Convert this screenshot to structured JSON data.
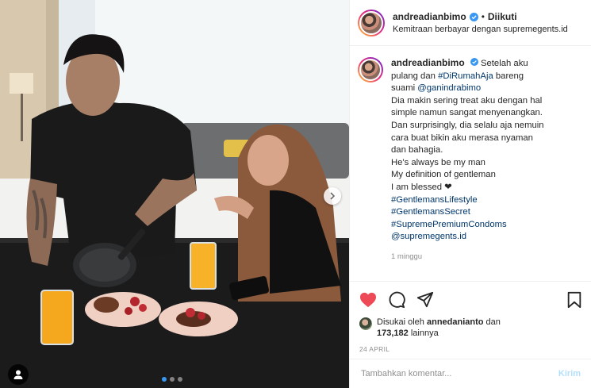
{
  "post": {
    "username": "andreadianbimo",
    "follow_status": "Diikuti",
    "bullet": "•",
    "partnership_prefix": "Kemitraan berbayar dengan ",
    "partner": "supremegents.id"
  },
  "caption": {
    "username": "andreadianbimo",
    "line1": "Setelah aku",
    "line2": "pulang dan ",
    "hashtag1": "#DiRumahAja",
    "line2b": " bareng",
    "line3": "suami ",
    "mention1": "@ganindrabimo",
    "line4": "Dia makin sering treat aku dengan hal",
    "line5": "simple namun sangat menyenangkan.",
    "line6": "Dan surprisingly, dia selalu aja nemuin",
    "line7": "cara buat bikin aku merasa nyaman",
    "line8": "dan bahagia.",
    "line9": "He's always be my man",
    "line10": "My definition of gentleman",
    "line11": "I am blessed ❤",
    "hashtag2": "#GentlemansLifestyle",
    "hashtag3": "#GentlemansSecret",
    "hashtag4": "#SupremePremiumCondoms",
    "mention2": "@supremegents.id",
    "time_ago": "1 minggu"
  },
  "actions": {
    "like_icon": "heart-filled-icon",
    "comment_icon": "comment-icon",
    "share_icon": "share-icon",
    "save_icon": "bookmark-icon",
    "like_color": "#ed4956"
  },
  "likes": {
    "prefix": "Disukai oleh ",
    "liker": "annedanianto",
    "middle": " dan",
    "count": "173,182",
    "suffix": " lainnya"
  },
  "post_date": "24 APRIL",
  "comment": {
    "placeholder": "Tambahkan komentar...",
    "post_label": "Kirim"
  },
  "carousel": {
    "total_slides": 3,
    "active_slide": 1
  },
  "colors": {
    "link": "#00376b",
    "carousel_active": "#3897f0",
    "verified": "#3897f0"
  }
}
